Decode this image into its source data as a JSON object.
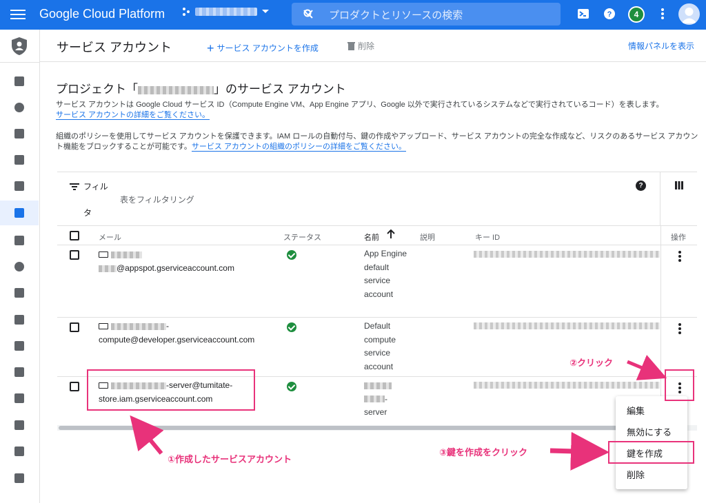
{
  "topbar": {
    "brand": "Google Cloud Platform",
    "search_placeholder": "プロダクトとリソースの検索",
    "notification_count": "4"
  },
  "header": {
    "title": "サービス アカウント",
    "create_label": "サービス アカウントを作成",
    "delete_label": "削除",
    "info_panel_label": "情報パネルを表示"
  },
  "content": {
    "heading_prefix": "プロジェクト「",
    "heading_suffix": "」のサービス アカウント",
    "desc1_text": "サービス アカウントは Google Cloud サービス ID（Compute Engine VM、App Engine アプリ、Google 以外で実行されているシステムなどで実行されているコード）を表します。",
    "desc1_link": "サービス アカウントの詳細をご覧ください。",
    "desc2_text": "組織のポリシーを使用してサービス アカウントを保護できます。IAM ロールの自動付与、鍵の作成やアップロード、サービス アカウントの完全な作成など、リスクのあるサービス アカウント機能をブロックすることが可能です。",
    "desc2_link": "サービス アカウントの組織のポリシーの詳細をご覧ください。"
  },
  "filter": {
    "label_line1": "フィル",
    "label_line2": "タ",
    "placeholder": "表をフィルタリング"
  },
  "table": {
    "headers": {
      "email": "メール",
      "status": "ステータス",
      "name": "名前",
      "description": "説明",
      "key_id": "キー ID",
      "actions": "操作"
    },
    "rows": [
      {
        "email_line2": "@appspot.gserviceaccount.com",
        "name": "App Engine default service account"
      },
      {
        "email_line1_suffix": "-",
        "email_line2": "compute@developer.gserviceaccount.com",
        "name": "Default compute service account"
      },
      {
        "email_line1_suffix": "-server@tumitate-",
        "email_line2": "store.iam.gserviceaccount.com",
        "name_suffix": "-",
        "name_line3": "server"
      }
    ]
  },
  "menu": {
    "items": [
      "編集",
      "無効にする",
      "鍵を作成",
      "削除"
    ]
  },
  "annotations": {
    "step1": "①作成したサービスアカウント",
    "step2": "②クリック",
    "step3": "③鍵を作成をクリック",
    "color": "#e8327a"
  }
}
